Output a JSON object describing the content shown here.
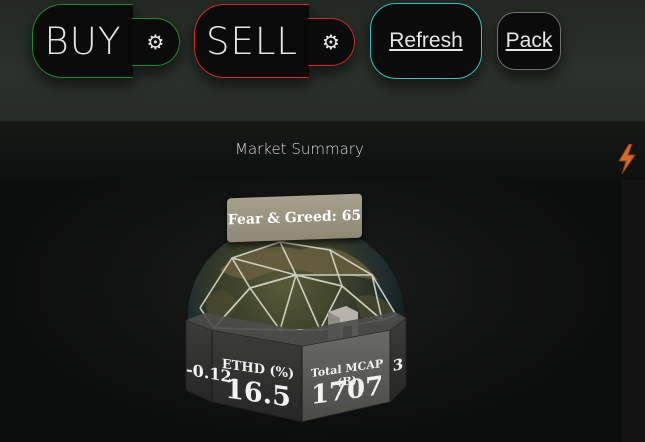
{
  "toolbar": {
    "buy_label": "BUY",
    "sell_label": "SELL",
    "refresh_label": "Refresh",
    "pack_label": "Pack",
    "gear_icon": "gear-icon"
  },
  "summary": {
    "title": "Market Summary",
    "fear_greed": "Fear & Greed: 65",
    "panels": {
      "left_value": "-0.12",
      "left_label": "...",
      "ethd_label": "ETHD (%)",
      "ethd_value": "16.5",
      "mcap_label": "Total MCAP (B)",
      "mcap_value": "1707",
      "right_value": "3"
    }
  },
  "colors": {
    "buy": "#1c8a2c",
    "sell": "#cf2a2a",
    "refresh": "#2ec4c4",
    "bolt": "#d9692a"
  }
}
